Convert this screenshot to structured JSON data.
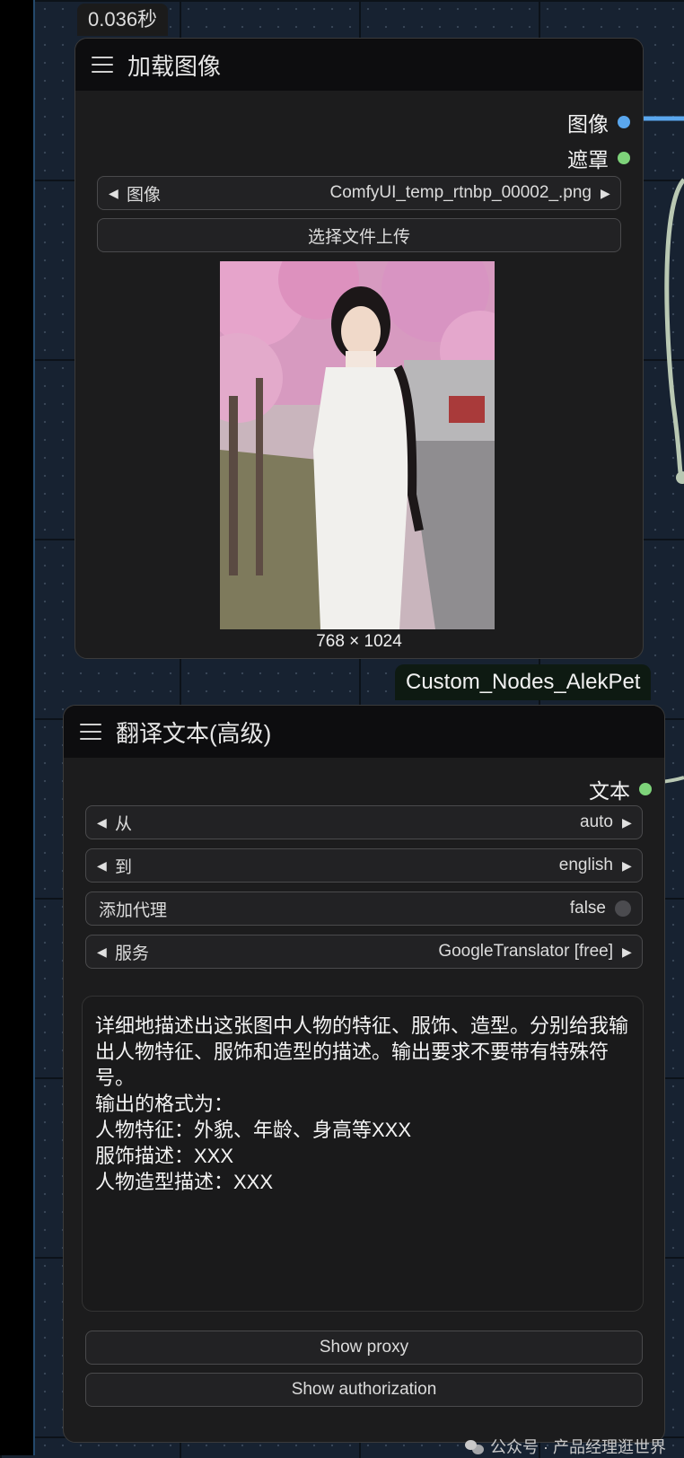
{
  "timer": "0.036秒",
  "load_image_node": {
    "title": "加载图像",
    "outputs": [
      {
        "label": "图像",
        "color": "#5aa7ee"
      },
      {
        "label": "遮罩",
        "color": "#7ed37a"
      }
    ],
    "image_widget": {
      "label": "图像",
      "value": "ComfyUI_temp_rtnbp_00002_.png"
    },
    "upload_button": "选择文件上传",
    "image_size": "768 × 1024"
  },
  "group_tag": "Custom_Nodes_AlekPet",
  "translate_node": {
    "title": "翻译文本(高级)",
    "output": {
      "label": "文本",
      "color": "#7ed37a"
    },
    "from_widget": {
      "label": "从",
      "value": "auto"
    },
    "to_widget": {
      "label": "到",
      "value": "english"
    },
    "proxy_widget": {
      "label": "添加代理",
      "value": "false"
    },
    "service_widget": {
      "label": "服务",
      "value": "GoogleTranslator [free]"
    },
    "prompt_text": "详细地描述出这张图中人物的特征、服饰、造型。分别给我输出人物特征、服饰和造型的描述。输出要求不要带有特殊符号。\n输出的格式为：\n人物特征：外貌、年龄、身高等XXX\n服饰描述：XXX\n人物造型描述：XXX",
    "show_proxy_button": "Show proxy",
    "show_auth_button": "Show authorization"
  },
  "watermark": "公众号 · 产品经理逛世界"
}
